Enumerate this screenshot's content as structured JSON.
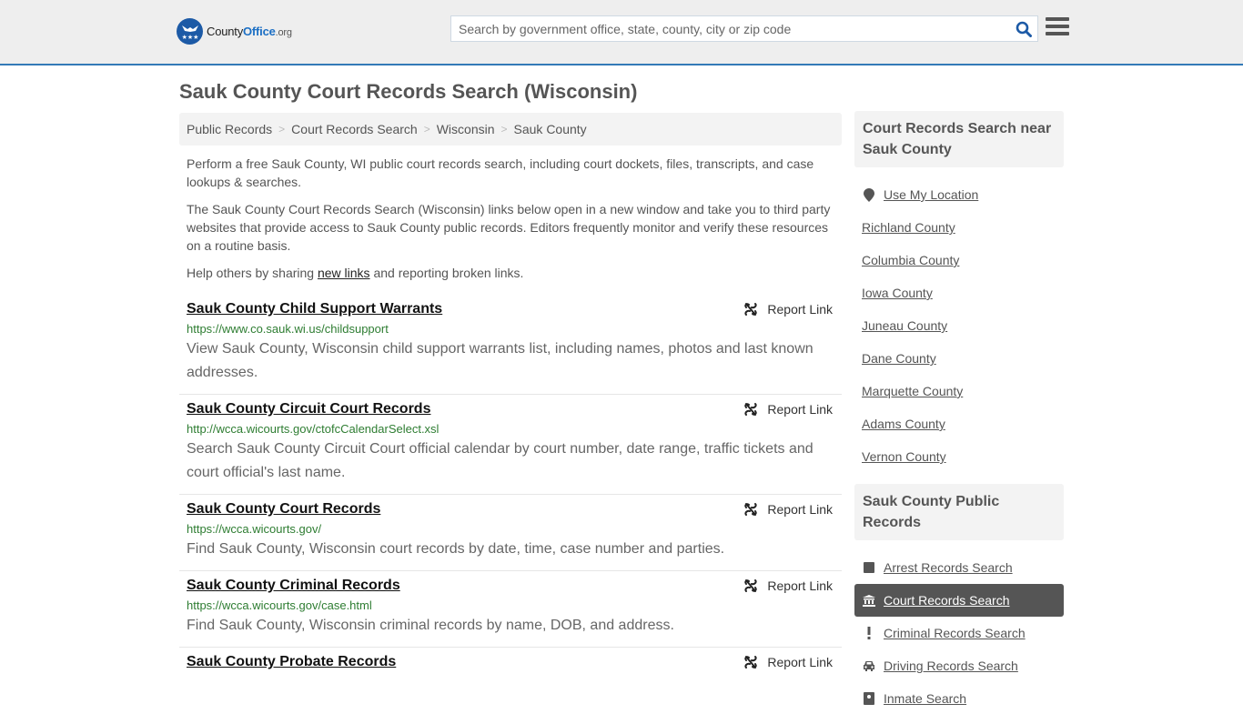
{
  "header": {
    "logo": {
      "part1": "County",
      "part2": "Office",
      "part3": ".org"
    },
    "search_placeholder": "Search by government office, state, county, city or zip code",
    "search_value": ""
  },
  "page_title": "Sauk County Court Records Search (Wisconsin)",
  "breadcrumb": [
    "Public Records",
    "Court Records Search",
    "Wisconsin",
    "Sauk County"
  ],
  "intro": {
    "p1": "Perform a free Sauk County, WI public court records search, including court dockets, files, transcripts, and case lookups & searches.",
    "p2": "The Sauk County Court Records Search (Wisconsin) links below open in a new window and take you to third party websites that provide access to Sauk County public records. Editors frequently monitor and verify these resources on a routine basis.",
    "p3_before": "Help others by sharing ",
    "p3_link": "new links",
    "p3_after": " and reporting broken links."
  },
  "report_label": "Report Link",
  "results": [
    {
      "title": "Sauk County Child Support Warrants",
      "url": "https://www.co.sauk.wi.us/childsupport",
      "desc": "View Sauk County, Wisconsin child support warrants list, including names, photos and last known addresses."
    },
    {
      "title": "Sauk County Circuit Court Records",
      "url": "http://wcca.wicourts.gov/ctofcCalendarSelect.xsl",
      "desc": "Search Sauk County Circuit Court official calendar by court number, date range, traffic tickets and court official's last name."
    },
    {
      "title": "Sauk County Court Records",
      "url": "https://wcca.wicourts.gov/",
      "desc": "Find Sauk County, Wisconsin court records by date, time, case number and parties."
    },
    {
      "title": "Sauk County Criminal Records",
      "url": "https://wcca.wicourts.gov/case.html",
      "desc": "Find Sauk County, Wisconsin criminal records by name, DOB, and address."
    },
    {
      "title": "Sauk County Probate Records",
      "url": "",
      "desc": ""
    }
  ],
  "sidebar": {
    "nearby": {
      "heading": "Court Records Search near Sauk County",
      "use_location": "Use My Location",
      "counties": [
        "Richland County",
        "Columbia County",
        "Iowa County",
        "Juneau County",
        "Dane County",
        "Marquette County",
        "Adams County",
        "Vernon County"
      ]
    },
    "public_records": {
      "heading": "Sauk County Public Records",
      "items": [
        {
          "label": "Arrest Records Search",
          "icon": "square-icon",
          "active": false
        },
        {
          "label": "Court Records Search",
          "icon": "courthouse-icon",
          "active": true
        },
        {
          "label": "Criminal Records Search",
          "icon": "exclamation-icon",
          "active": false
        },
        {
          "label": "Driving Records Search",
          "icon": "car-icon",
          "active": false
        },
        {
          "label": "Inmate Search",
          "icon": "inmate-icon",
          "active": false
        }
      ]
    }
  }
}
